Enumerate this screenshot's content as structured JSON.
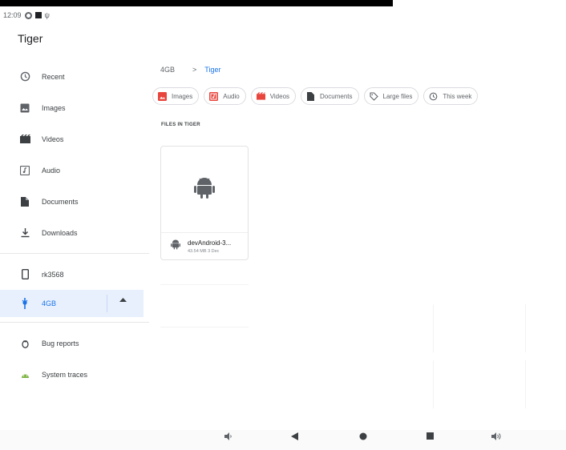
{
  "status_bar": {
    "time": "12:09"
  },
  "app": {
    "title": "Tiger"
  },
  "drawer": {
    "roots": [
      {
        "label": "Recent",
        "icon": "clock-icon"
      },
      {
        "label": "Images",
        "icon": "image-icon"
      },
      {
        "label": "Videos",
        "icon": "movie-icon"
      },
      {
        "label": "Audio",
        "icon": "audio-icon"
      },
      {
        "label": "Documents",
        "icon": "document-icon"
      },
      {
        "label": "Downloads",
        "icon": "download-icon"
      }
    ],
    "devices": [
      {
        "label": "rk3568",
        "icon": "phone-icon"
      },
      {
        "label": "4GB",
        "icon": "usb-icon",
        "active": true
      }
    ],
    "tools": [
      {
        "label": "Bug reports",
        "icon": "bug-report-icon"
      },
      {
        "label": "System traces",
        "icon": "android-icon"
      }
    ]
  },
  "breadcrumb": {
    "root": "4GB",
    "separator": ">",
    "current": "Tiger"
  },
  "chips": [
    {
      "label": "Images",
      "icon": "image-icon"
    },
    {
      "label": "Audio",
      "icon": "audio-icon"
    },
    {
      "label": "Videos",
      "icon": "movie-icon"
    },
    {
      "label": "Documents",
      "icon": "document-icon"
    },
    {
      "label": "Large files",
      "icon": "tag-icon"
    },
    {
      "label": "This week",
      "icon": "history-icon"
    }
  ],
  "section_label": "FILES IN TIGER",
  "files": [
    {
      "name": "devAndroid-3...",
      "details": "43.54 MB 3 Dec",
      "icon": "android-icon"
    }
  ],
  "colors": {
    "accent": "#1a73e8",
    "chip_red": "#e8453c",
    "active_bg": "#e8f0fe"
  }
}
